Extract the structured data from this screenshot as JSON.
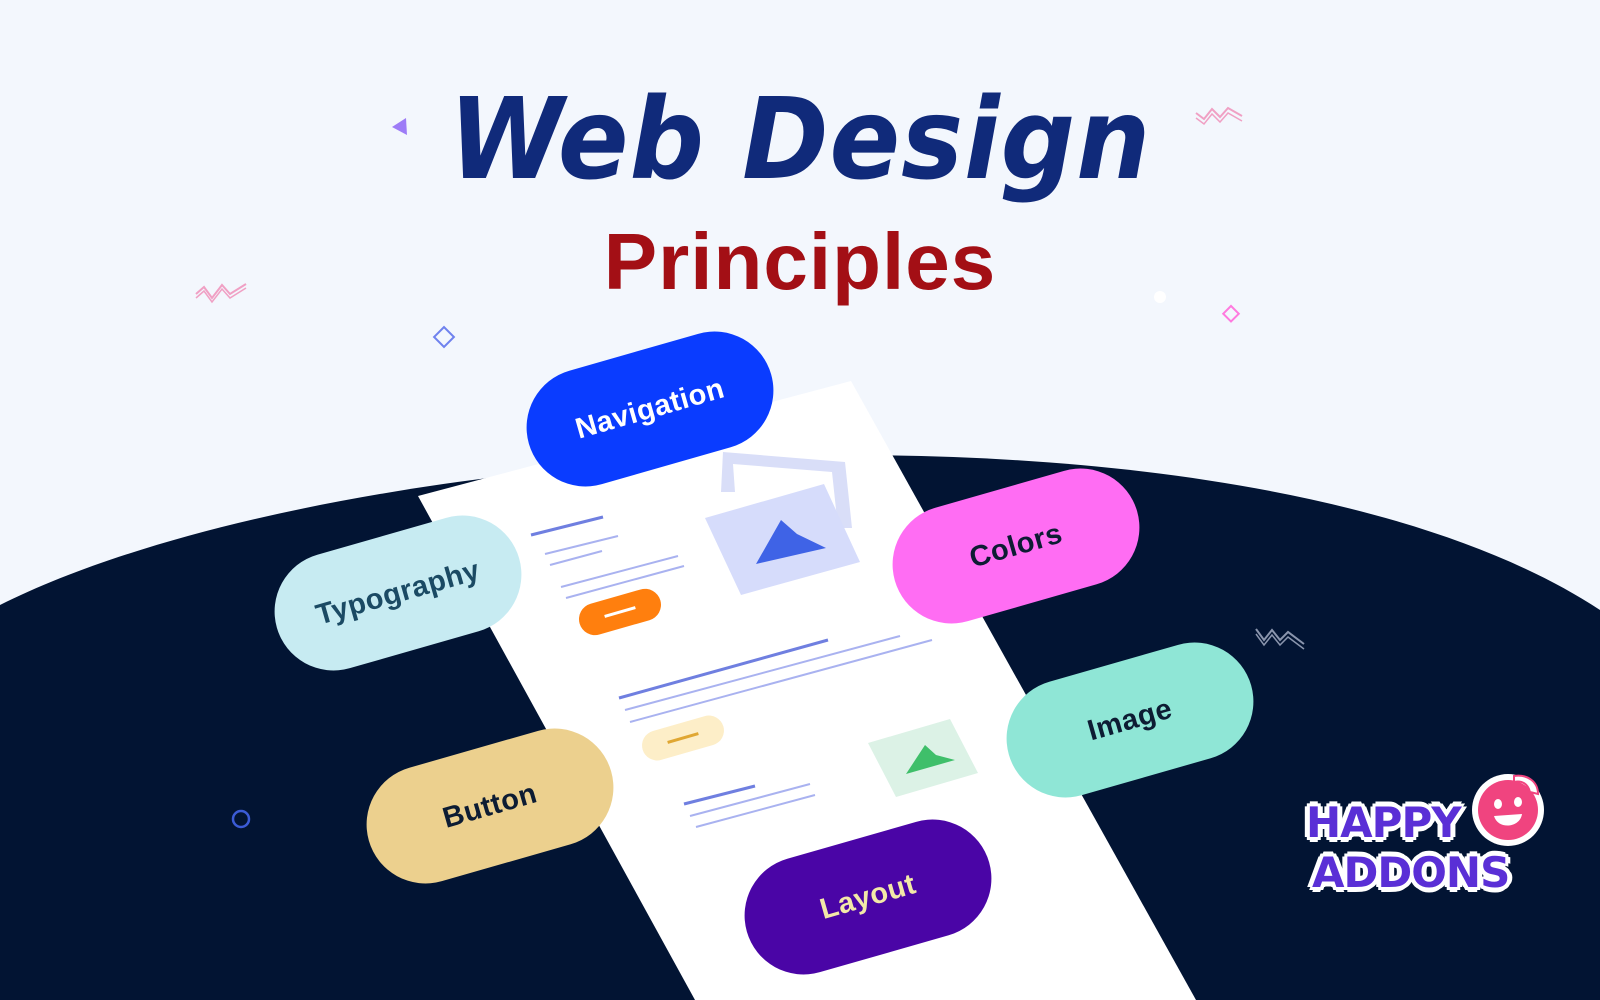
{
  "title": {
    "main": "Web Design",
    "sub": "Principles"
  },
  "pills": [
    {
      "label": "Navigation",
      "bg": "#0a3cff",
      "fg": "#ffffff"
    },
    {
      "label": "Typography",
      "bg": "#c7ebf2",
      "fg": "#1b4a64"
    },
    {
      "label": "Colors",
      "bg": "#ff6df3",
      "fg": "#0d1c33"
    },
    {
      "label": "Image",
      "bg": "#8fe6d6",
      "fg": "#0d1c33"
    },
    {
      "label": "Button",
      "bg": "#ecd08e",
      "fg": "#0d1c33"
    },
    {
      "label": "Layout",
      "bg": "#4a05a6",
      "fg": "#f3e9a8"
    }
  ],
  "logo": {
    "line1": "HAPPY",
    "line2": "ADDONS",
    "color": "#5a2fd6"
  },
  "colors": {
    "background": "#f3f7fd",
    "dark": "#021433",
    "title_main": "#102a7a",
    "title_sub": "#a30f15"
  }
}
